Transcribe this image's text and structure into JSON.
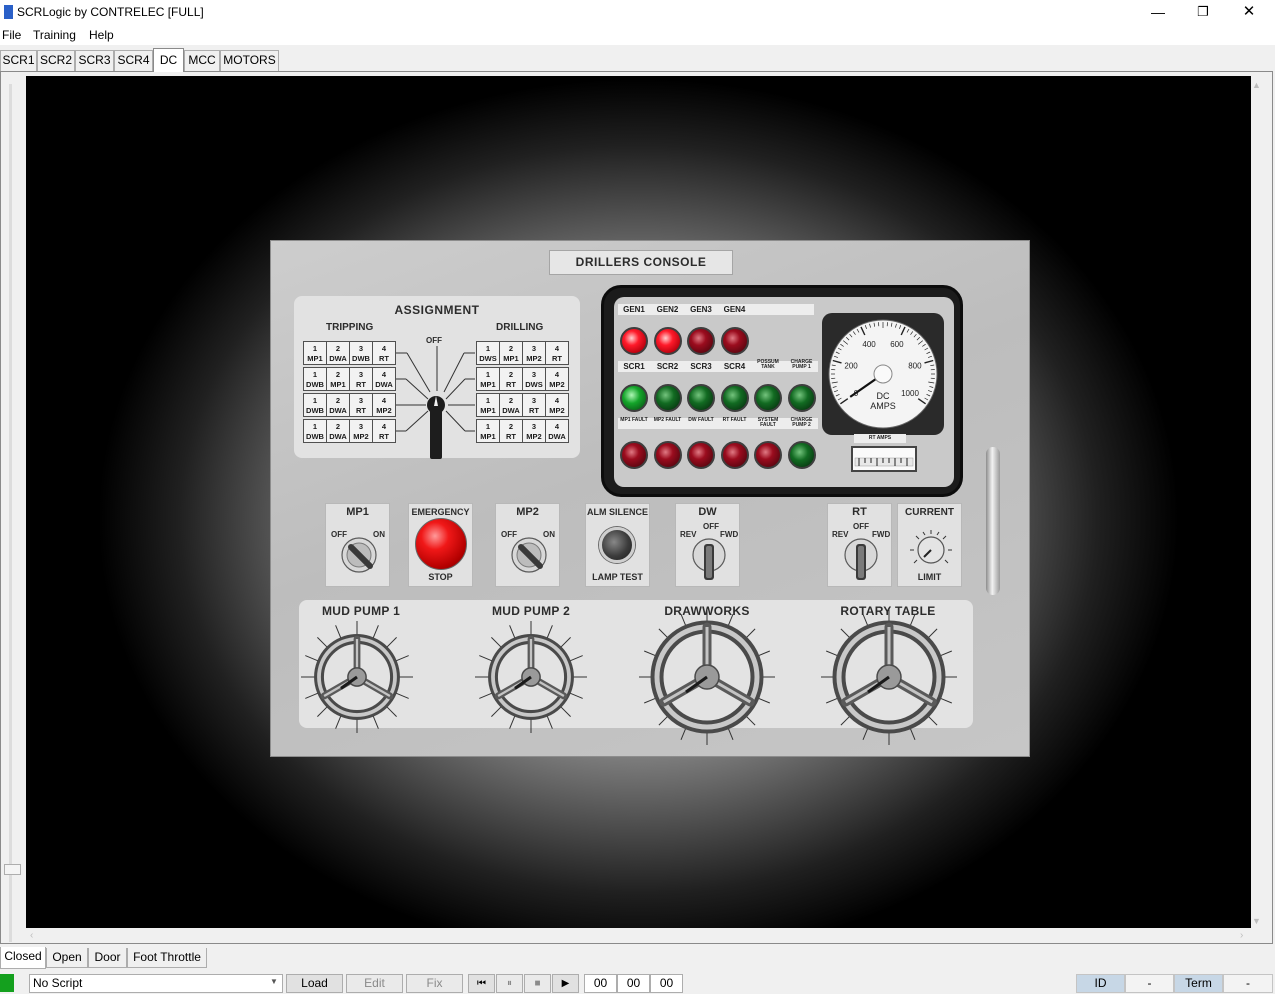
{
  "window": {
    "title": "SCRLogic by CONTRELEC [FULL]",
    "min_glyph": "—",
    "max_glyph": "❐",
    "close_glyph": "✕"
  },
  "menu": {
    "items": [
      "File",
      "Training",
      "Help"
    ]
  },
  "tabs": {
    "items": [
      "SCR1",
      "SCR2",
      "SCR3",
      "SCR4",
      "DC",
      "MCC",
      "MOTORS"
    ],
    "active": "DC"
  },
  "console": {
    "title": "DRILLERS CONSOLE",
    "assignment": {
      "title": "ASSIGNMENT",
      "left_label": "TRIPPING",
      "right_label": "DRILLING",
      "off_label": "OFF",
      "tripping_rows": [
        [
          [
            "1",
            "MP1"
          ],
          [
            "2",
            "DWA"
          ],
          [
            "3",
            "DWB"
          ],
          [
            "4",
            "RT"
          ]
        ],
        [
          [
            "1",
            "DWB"
          ],
          [
            "2",
            "MP1"
          ],
          [
            "3",
            "RT"
          ],
          [
            "4",
            "DWA"
          ]
        ],
        [
          [
            "1",
            "DWB"
          ],
          [
            "2",
            "DWA"
          ],
          [
            "3",
            "RT"
          ],
          [
            "4",
            "MP2"
          ]
        ],
        [
          [
            "1",
            "DWB"
          ],
          [
            "2",
            "DWA"
          ],
          [
            "3",
            "MP2"
          ],
          [
            "4",
            "RT"
          ]
        ]
      ],
      "drilling_rows": [
        [
          [
            "1",
            "DWS"
          ],
          [
            "2",
            "MP1"
          ],
          [
            "3",
            "MP2"
          ],
          [
            "4",
            "RT"
          ]
        ],
        [
          [
            "1",
            "MP1"
          ],
          [
            "2",
            "RT"
          ],
          [
            "3",
            "DWS"
          ],
          [
            "4",
            "MP2"
          ]
        ],
        [
          [
            "1",
            "MP1"
          ],
          [
            "2",
            "DWA"
          ],
          [
            "3",
            "RT"
          ],
          [
            "4",
            "MP2"
          ]
        ],
        [
          [
            "1",
            "MP1"
          ],
          [
            "2",
            "RT"
          ],
          [
            "3",
            "MP2"
          ],
          [
            "4",
            "DWA"
          ]
        ]
      ]
    },
    "annunciator": {
      "gen_labels": [
        "GEN1",
        "GEN2",
        "GEN3",
        "GEN4"
      ],
      "gen_states": [
        "on",
        "on",
        "off",
        "off"
      ],
      "scr_labels": [
        "SCR1",
        "SCR2",
        "SCR3",
        "SCR4",
        "POSSUM TANK",
        "CHARGE PUMP 1"
      ],
      "scr_states": [
        "bright",
        "dim",
        "dim",
        "dim",
        "dim",
        "dim"
      ],
      "fault_labels": [
        "MP1 FAULT",
        "MP2 FAULT",
        "DW FAULT",
        "RT FAULT",
        "SYSTEM FAULT",
        "CHARGE PUMP 2"
      ],
      "fault_states": [
        "red",
        "red",
        "red",
        "red",
        "red",
        "green"
      ],
      "colors": {
        "red_on": "#ff1a2a",
        "red_off": "#9b0c1e",
        "green": "#14a52a"
      }
    },
    "gauge": {
      "scale_labels": [
        "0",
        "200",
        "400",
        "600",
        "800",
        "1000"
      ],
      "unit_line1": "DC",
      "unit_line2": "AMPS",
      "min": 0,
      "max": 1000,
      "value": 0,
      "meter_label": "RT AMPS"
    },
    "switches": {
      "mp1": {
        "title": "MP1",
        "off": "OFF",
        "on": "ON"
      },
      "estop": {
        "title": "EMERGENCY",
        "bottom": "STOP"
      },
      "mp2": {
        "title": "MP2",
        "off": "OFF",
        "on": "ON"
      },
      "alm": {
        "title": "ALM SILENCE",
        "bottom": "LAMP TEST"
      },
      "dw": {
        "title": "DW",
        "off": "OFF",
        "rev": "REV",
        "fwd": "FWD"
      },
      "rt": {
        "title": "RT",
        "off": "OFF",
        "rev": "REV",
        "fwd": "FWD"
      },
      "current": {
        "title": "CURRENT",
        "bottom": "LIMIT"
      }
    },
    "throttles": [
      {
        "label": "MUD PUMP 1"
      },
      {
        "label": "MUD PUMP 2"
      },
      {
        "label": "DRAWWORKS"
      },
      {
        "label": "ROTARY TABLE"
      }
    ]
  },
  "bottom_tabs": {
    "items": [
      "Closed",
      "Open",
      "Door",
      "Foot Throttle"
    ],
    "active": "Closed"
  },
  "scriptbar": {
    "script_value": "No Script",
    "load": "Load",
    "edit": "Edit",
    "fix": "Fix",
    "transport": [
      "⏮",
      "⏸",
      "■",
      "▶"
    ],
    "time": [
      "00",
      "00",
      "00"
    ],
    "id_label": "ID",
    "id_value": "-",
    "term_label": "Term",
    "term_value": "-"
  }
}
